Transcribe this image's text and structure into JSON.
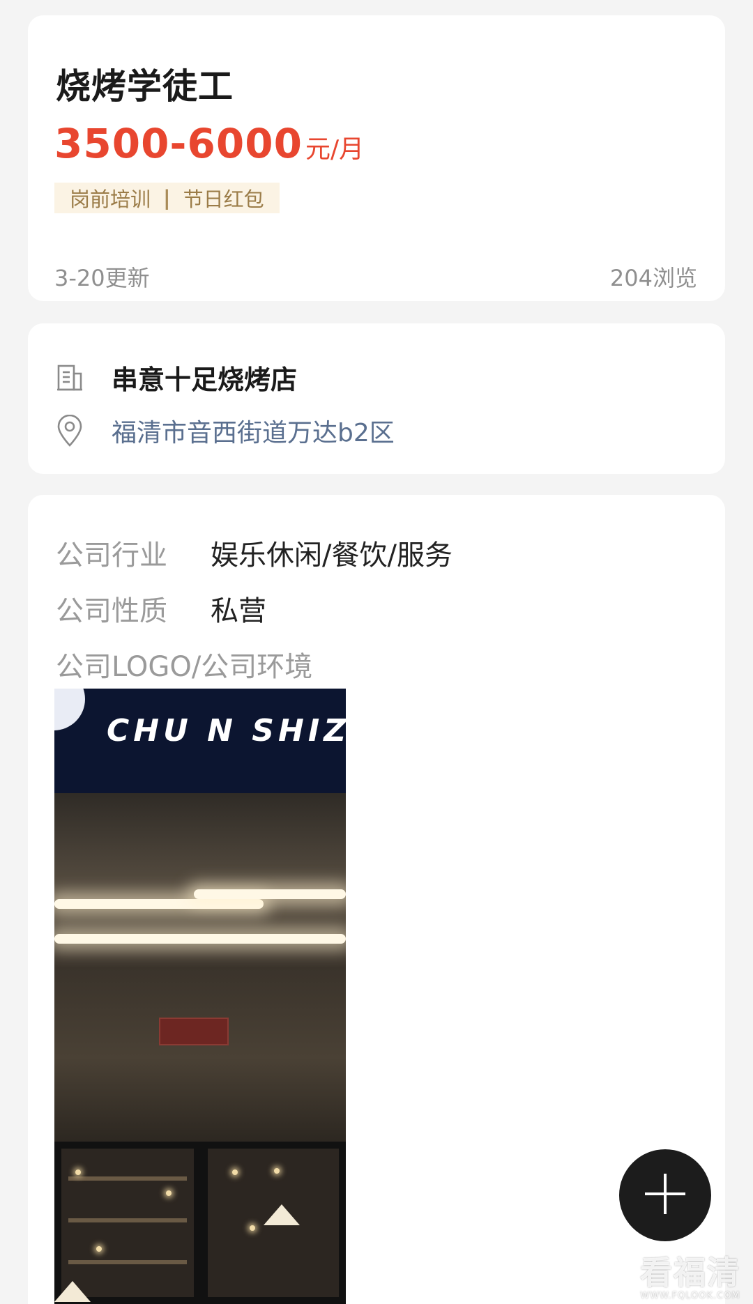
{
  "job": {
    "title": "烧烤学徒工",
    "salary_range": "3500-6000",
    "salary_unit": "元/月",
    "tags": [
      "岗前培训",
      "节日红包"
    ],
    "tag_separator": "|",
    "updated": "3-20更新",
    "views": "204浏览"
  },
  "company": {
    "name": "串意十足烧烤店",
    "address": "福清市音西街道万达b2区",
    "name_icon": "building-icon",
    "address_icon": "location-pin-icon"
  },
  "details": {
    "industry_label": "公司行业",
    "industry_value": "娱乐休闲/餐饮/服务",
    "nature_label": "公司性质",
    "nature_value": "私营",
    "environment_label": "公司LOGO/公司环境"
  },
  "photo": {
    "sign_text": "CHU N  SHIZ"
  },
  "fab": {
    "icon": "plus-icon"
  },
  "watermark": {
    "main": "看福清",
    "sub": "WWW.FQLOOK.COM"
  },
  "colors": {
    "salary": "#e8462f",
    "tag_bg": "#fbf3e4",
    "tag_text": "#9b7c48",
    "address": "#5a6f8f",
    "fab": "#1c1c1c"
  }
}
